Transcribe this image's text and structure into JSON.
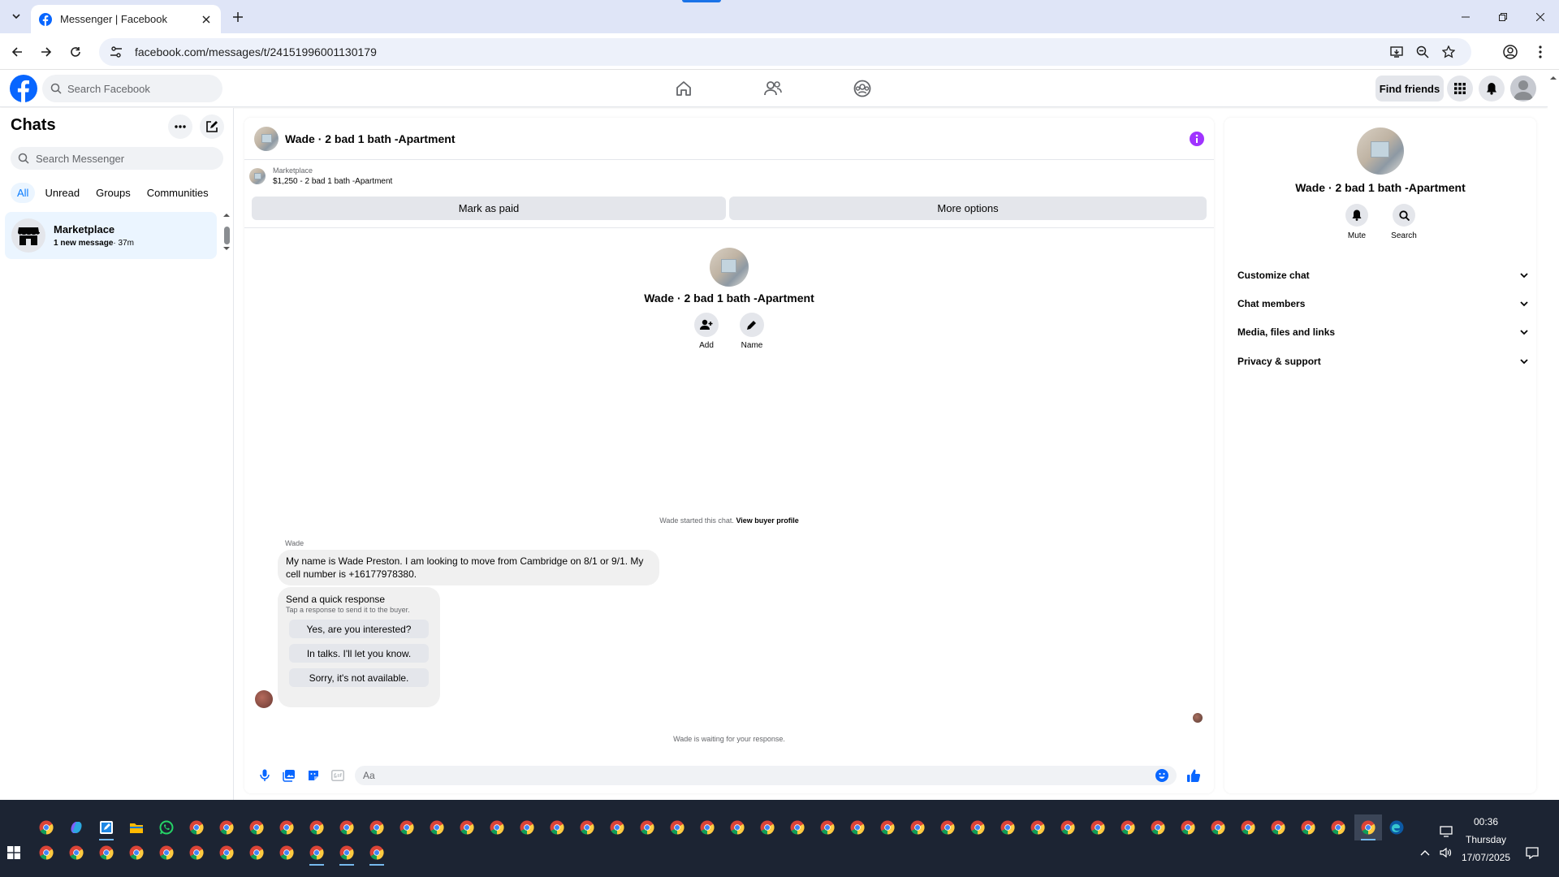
{
  "browser": {
    "tab_title": "Messenger | Facebook",
    "url": "facebook.com/messages/t/24151996001130179"
  },
  "fb_header": {
    "search_placeholder": "Search Facebook",
    "find_friends": "Find friends"
  },
  "sidebar": {
    "title": "Chats",
    "search_placeholder": "Search Messenger",
    "filters": [
      "All",
      "Unread",
      "Groups",
      "Communities"
    ],
    "chats": [
      {
        "name": "Marketplace",
        "preview": "1 new message",
        "time": "· 37m"
      }
    ]
  },
  "conversation": {
    "title": "Wade · 2 bad 1 bath -Apartment",
    "marketplace_label": "Marketplace",
    "listing": "$1,250 - 2 bad 1 bath -Apartment",
    "mark_paid": "Mark as paid",
    "more_options": "More options",
    "intro_name": "Wade · 2 bad 1 bath -Apartment",
    "intro_add": "Add",
    "intro_name_btn": "Name",
    "started_text": "Wade started this chat.",
    "view_buyer": "View buyer profile",
    "sender": "Wade",
    "message": "My name is Wade Preston. I am looking to move from Cambridge on 8/1 or 9/1. My cell number is +16177978380.",
    "quick_title": "Send a quick response",
    "quick_sub": "Tap a response to send it to the buyer.",
    "quick_replies": [
      "Yes, are you interested?",
      "In talks. I'll let you know.",
      "Sorry, it's not available."
    ],
    "waiting": "Wade is waiting for your response.",
    "composer_placeholder": "Aa"
  },
  "info_panel": {
    "name": "Wade · 2 bad 1 bath -Apartment",
    "mute": "Mute",
    "search": "Search",
    "sections": [
      "Customize chat",
      "Chat members",
      "Media, files and links",
      "Privacy & support"
    ]
  },
  "taskbar": {
    "time": "00:36",
    "day": "Thursday",
    "date": "17/07/2025"
  },
  "colors": {
    "fb_blue": "#0866ff",
    "messenger_purple": "#a033ff",
    "active_chat_bg": "#ebf5ff",
    "taskbar_bg": "#1c2433"
  }
}
